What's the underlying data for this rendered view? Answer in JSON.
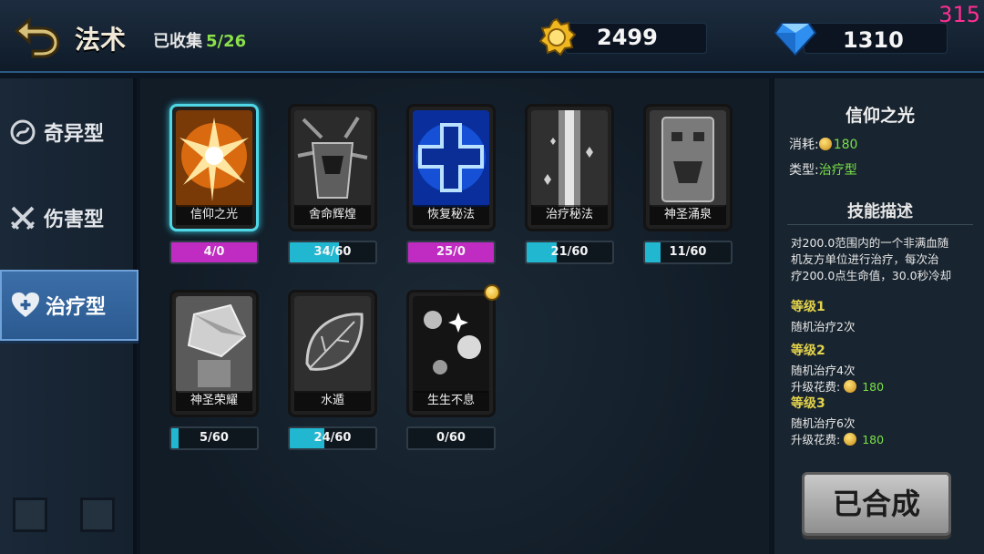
{
  "header": {
    "title": "法术",
    "collected_label": "已收集",
    "collected_count": "5/26",
    "gold": "2499",
    "gems": "1310",
    "debug_number": "315"
  },
  "sidebar": {
    "items": [
      {
        "label": "奇异型",
        "icon": "swirl-icon",
        "active": false
      },
      {
        "label": "伤害型",
        "icon": "crossed-swords-icon",
        "active": false
      },
      {
        "label": "治疗型",
        "icon": "heart-plus-icon",
        "active": true
      }
    ]
  },
  "cards": [
    {
      "name": "信仰之光",
      "progress": "4/0",
      "fill_fraction": 1.0,
      "bar_color": "#c02bc2",
      "selected": true,
      "icon": "light-burst-icon"
    },
    {
      "name": "舍命辉煌",
      "progress": "34/60",
      "fill_fraction": 0.57,
      "bar_color": "#21b7d0",
      "selected": false,
      "icon": "beast-spirit-icon"
    },
    {
      "name": "恢复秘法",
      "progress": "25/0",
      "fill_fraction": 1.0,
      "bar_color": "#c02bc2",
      "selected": false,
      "icon": "blue-cross-icon"
    },
    {
      "name": "治疗秘法",
      "progress": "21/60",
      "fill_fraction": 0.35,
      "bar_color": "#21b7d0",
      "selected": false,
      "icon": "light-beam-icon"
    },
    {
      "name": "神圣涌泉",
      "progress": "11/60",
      "fill_fraction": 0.18,
      "bar_color": "#21b7d0",
      "selected": false,
      "icon": "totem-icon"
    },
    {
      "name": "神圣荣耀",
      "progress": "5/60",
      "fill_fraction": 0.08,
      "bar_color": "#21b7d0",
      "selected": false,
      "icon": "crystal-icon"
    },
    {
      "name": "水遁",
      "progress": "24/60",
      "fill_fraction": 0.4,
      "bar_color": "#21b7d0",
      "selected": false,
      "icon": "leaf-icon"
    },
    {
      "name": "生生不息",
      "progress": "0/60",
      "fill_fraction": 0.0,
      "bar_color": "#21b7d0",
      "selected": false,
      "icon": "sparkle-orbs-icon"
    }
  ],
  "detail": {
    "title": "信仰之光",
    "cost_label": "消耗:",
    "cost_value": "180",
    "type_label": "类型:",
    "type_value": "治疗型",
    "desc_header": "技能描述",
    "desc_line1": "对200.0范围内的一个非满血随",
    "desc_line2": "机友方单位进行治疗，每次治",
    "desc_line3": "疗200.0点生命值，30.0秒冷却",
    "levels": [
      {
        "title": "等级1",
        "effect": "随机治疗2次",
        "upgrade_label": "",
        "upgrade_cost": ""
      },
      {
        "title": "等级2",
        "effect": "随机治疗4次",
        "upgrade_label": "升级花费:",
        "upgrade_cost": "180"
      },
      {
        "title": "等级3",
        "effect": "随机治疗6次",
        "upgrade_label": "升级花费:",
        "upgrade_cost": "180"
      }
    ],
    "merged_button": "已合成"
  }
}
